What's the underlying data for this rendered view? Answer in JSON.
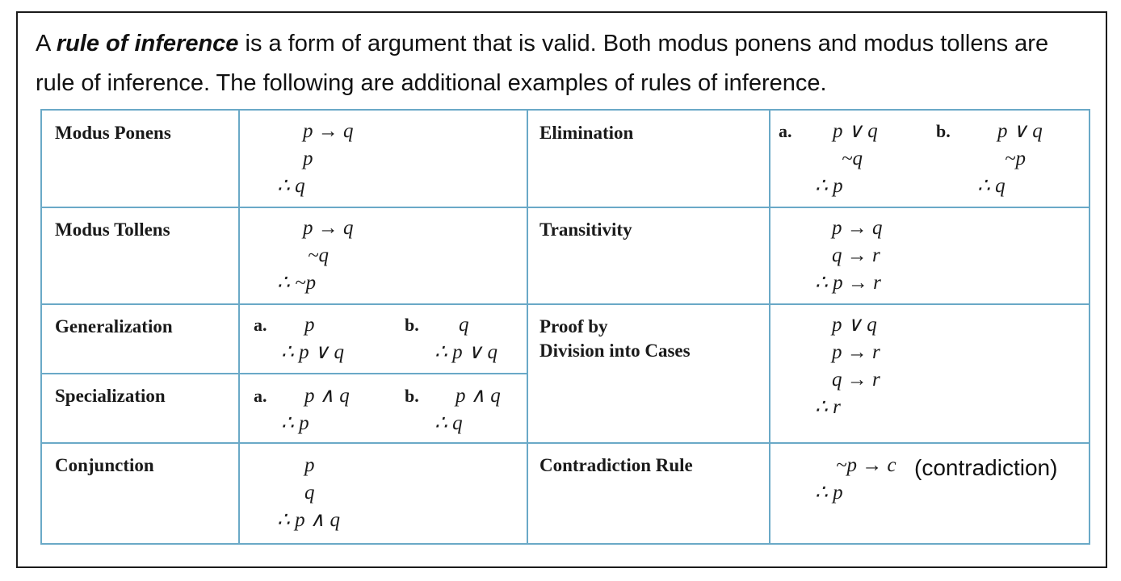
{
  "intro": {
    "prefix": "A ",
    "term": "rule of inference",
    "rest": " is a form of argument that is valid.  Both modus ponens and modus tollens are rule of inference.  The following are additional examples of rules of inference."
  },
  "rules": {
    "modus_ponens": {
      "name": "Modus Ponens",
      "lines": [
        "p → q",
        "p",
        "∴ q"
      ]
    },
    "modus_tollens": {
      "name": "Modus Tollens",
      "lines": [
        "p → q",
        "~q",
        "∴ ~p"
      ]
    },
    "generalization": {
      "name": "Generalization",
      "a": {
        "label": "a.",
        "lines": [
          "p",
          "∴ p ∨ q"
        ]
      },
      "b": {
        "label": "b.",
        "lines": [
          "q",
          "∴ p ∨ q"
        ]
      }
    },
    "specialization": {
      "name": "Specialization",
      "a": {
        "label": "a.",
        "lines": [
          "p ∧ q",
          "∴ p"
        ]
      },
      "b": {
        "label": "b.",
        "lines": [
          "p ∧ q",
          "∴ q"
        ]
      }
    },
    "conjunction": {
      "name": "Conjunction",
      "lines": [
        "p",
        "q",
        "∴ p ∧ q"
      ]
    },
    "elimination": {
      "name": "Elimination",
      "a": {
        "label": "a.",
        "lines": [
          "p ∨ q",
          "~q",
          "∴ p"
        ]
      },
      "b": {
        "label": "b.",
        "lines": [
          "p ∨ q",
          "~p",
          "∴ q"
        ]
      }
    },
    "transitivity": {
      "name": "Transitivity",
      "lines": [
        "p → q",
        "q → r",
        "∴ p → r"
      ]
    },
    "proof_by_cases": {
      "name_line1": "Proof by",
      "name_line2": "Division into Cases",
      "lines": [
        "p ∨ q",
        "p → r",
        "q → r",
        "∴ r"
      ]
    },
    "contradiction": {
      "name": "Contradiction Rule",
      "lines": [
        "~p → c",
        "∴ p"
      ],
      "note": "(contradiction)"
    }
  },
  "colors": {
    "table_border": "#6aa9c7",
    "frame_border": "#1a1a1a",
    "text": "#1a1a1a"
  }
}
